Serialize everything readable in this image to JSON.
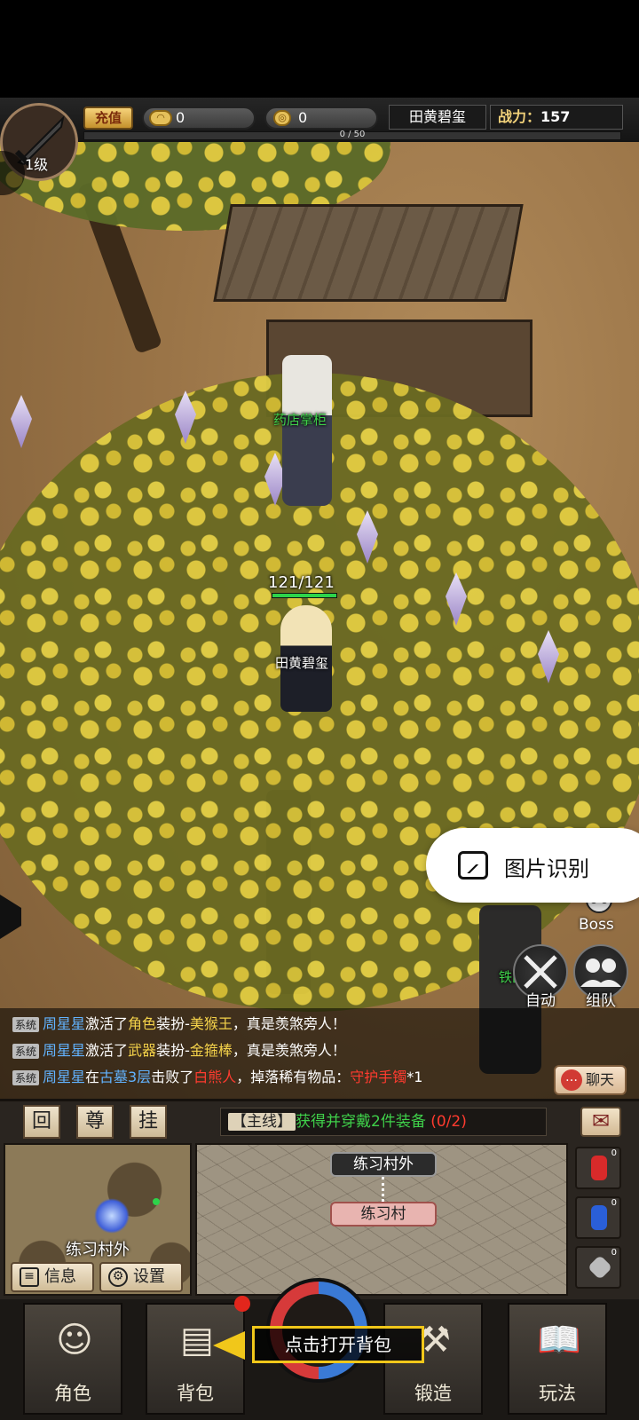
{
  "hud": {
    "level": "1级",
    "recharge": "充值",
    "ingots": "0",
    "coins": "0",
    "exp": "0 / 50",
    "player_name": "田黄碧玺",
    "power_label": "战力",
    "power_value": "157"
  },
  "scene": {
    "npc_name": "药店掌柜",
    "player_hp": "121/121",
    "player_name": "田黄碧玺",
    "partial_npc": "铁匠"
  },
  "actions": {
    "boss": "Boss",
    "auto": "自动",
    "team": "组队"
  },
  "overlay": {
    "image_recognition": "图片识别"
  },
  "chat": {
    "sys": "系统",
    "lines": [
      {
        "player": "周星星",
        "t1": "激活了",
        "item_type": "角色",
        "t2": "装扮-",
        "item": "美猴王",
        "t3": "，真是羡煞旁人！"
      },
      {
        "player": "周星星",
        "t1": "激活了",
        "item_type": "武器",
        "t2": "装扮-",
        "item": "金箍棒",
        "t3": "，真是羡煞旁人！"
      },
      {
        "player": "周星星",
        "t1": "在",
        "place": "古墓3层",
        "t2": "击败了",
        "boss": "白熊人",
        "t3": "，掉落稀有物品：",
        "drop": "守护手镯",
        "count": "*1"
      }
    ],
    "button": "聊天"
  },
  "panel": {
    "btn_back": "回",
    "btn_honor": "尊",
    "btn_idle": "挂",
    "quest_tag": "【主线】",
    "quest_text": "获得并穿戴2件装备",
    "quest_progress": "(0/2)",
    "minimap_name": "练习村外",
    "info_label": "信息",
    "settings_label": "设置",
    "node_upper": "练习村外",
    "node_current": "练习村",
    "potion_red_count": "0",
    "potion_blue_count": "0",
    "stone_count": "0"
  },
  "nav": {
    "role": "角色",
    "bag": "背包",
    "forge": "锻造",
    "play": "玩法",
    "tip": "点击打开背包"
  },
  "colors": {
    "quest_green": "#3fd04a",
    "highlight_red": "#ff3b2f",
    "player_blue": "#62b3ff",
    "item_yellow": "#f4d24a",
    "tip_border": "#f1c71a"
  }
}
